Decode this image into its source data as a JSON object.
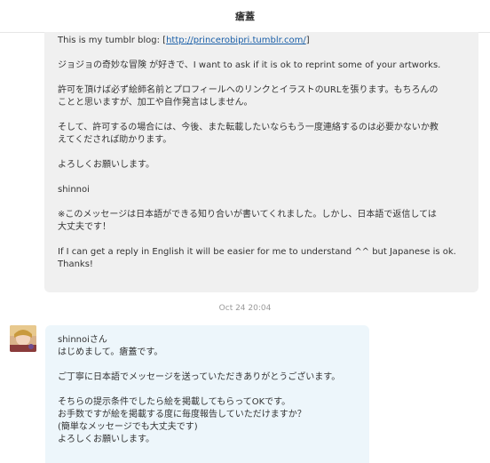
{
  "conversation": {
    "title": "瘡蓋"
  },
  "incoming_message": {
    "intro_before_link": "This is my tumblr blog: [",
    "blog_link": "http://princerobipri.tumblr.com/",
    "intro_after_link": "]",
    "p1": "ジョジョの奇妙な冒険 が好きで、I want to ask if it is ok to reprint some of your artworks.",
    "p2a": "許可を頂けば必ず絵師名前とプロフィールへのリンクとイラストのURLを張ります。もちろんの",
    "p2b": "ことと思いますが、加工や自作発言はしません。",
    "p3a": "そして、許可するの場合には、今後、また転載したいならもう一度連絡するのは必要かないか教",
    "p3b": "えてくだされば助かります。",
    "p4": "よろしくお願いします。",
    "signature": "shinnoi",
    "p5a": "※このメッセージは日本語ができる知り合いが書いてくれました。しかし、日本語で返信しては",
    "p5b": "大丈夫です！",
    "p6a": "If I can get a reply in English it will be easier for me to understand ^^ but Japanese is ok.",
    "p6b": "Thanks!"
  },
  "timestamp": "Oct 24 20:04",
  "outgoing_message": {
    "greeting": "shinnoiさん",
    "intro": "はじめまして。瘡蓋です。",
    "thanks": "ご丁寧に日本語でメッセージを送っていただきありがとうございます。",
    "cond1": "そちらの提示条件でしたら絵を掲載してもらってOKです。",
    "cond2": "お手数ですが絵を掲載する度に毎度報告していただけますか？",
    "cond3": "(簡単なメッセージでも大丈夫です)",
    "closing": "よろしくお願いします。"
  },
  "avatar": {
    "icon": "user-avatar-icon"
  }
}
